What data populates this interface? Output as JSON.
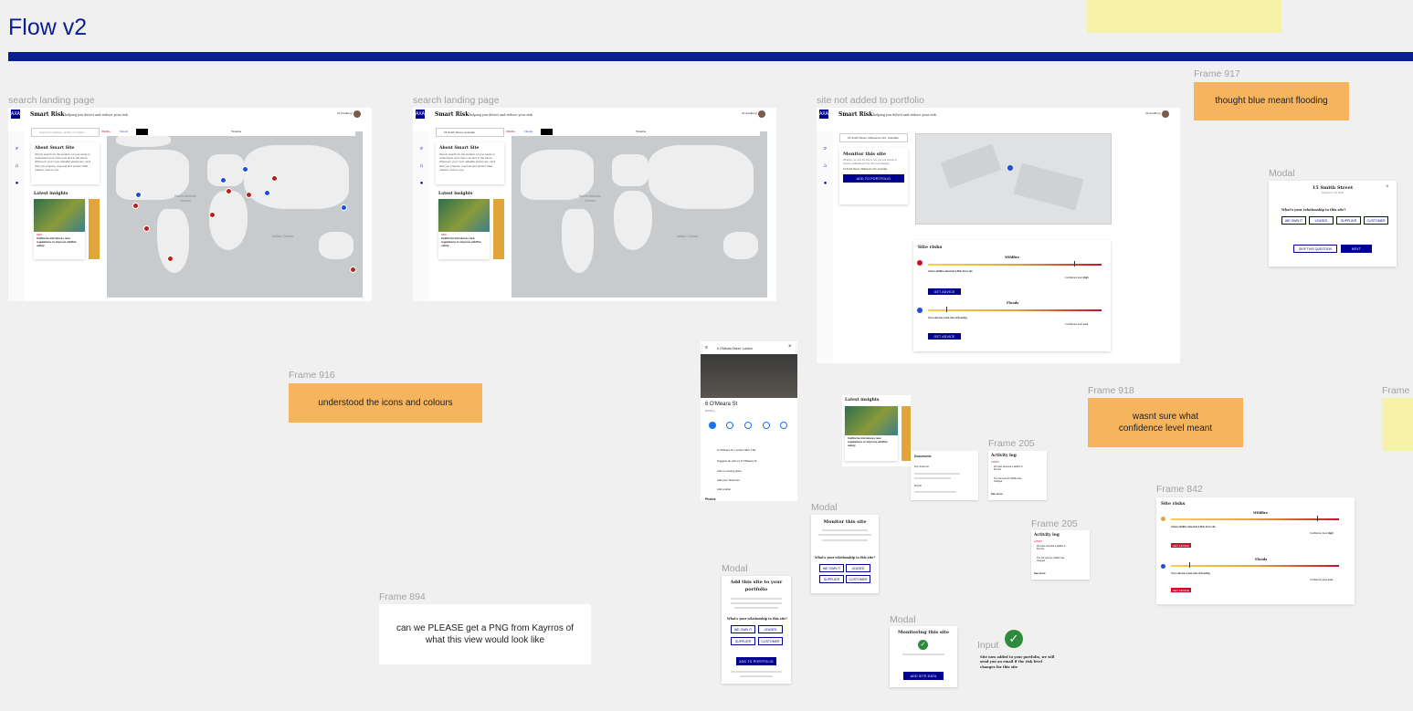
{
  "page_title": "Flow v2",
  "colors": {
    "brand_navy": "#00008f",
    "header_bar": "#0a1f8f",
    "risk_red": "#c8102e",
    "sticky_orange": "#f5b45d",
    "sticky_yellow": "#f6f3a8",
    "success_green": "#2e8b3e"
  },
  "frames": {
    "search1": "search landing page",
    "search2": "search landing page",
    "site_not_added": "site not added to portfolio",
    "f917": "Frame 917",
    "modal_right": "Modal",
    "f916": "Frame 916",
    "f918": "Frame 918",
    "frame_edge": "Frame",
    "f205a": "Frame 205",
    "f205b": "Frame 205",
    "f842": "Frame 842",
    "modal_mid": "Modal",
    "modal_left": "Modal",
    "f894": "Frame 894",
    "modal_bottom": "Modal",
    "input": "Input"
  },
  "notes": {
    "f917": "thought blue meant flooding",
    "f916": "understood the icons and colours",
    "f918": "wasnt sure what confidence level meant",
    "f894": "can we PLEASE get a PNG from Kayrros of what this view would look like"
  },
  "app": {
    "brand": "Smart Risk",
    "tagline": "helping you detect and reduce your risk",
    "user_name": "Ali Goldberg",
    "search_placeholder": "Search an address, facility or location",
    "search_value2": "15 Smith Street, Australia",
    "search_value3": "15 Smith Street, Melbourne VIC, Australia",
    "filter_wildfire": "Wildfire",
    "filter_floods": "Floods",
    "timeline": "Timeline",
    "about_title": "About Smart Site",
    "about_text": "Simply search for the location of your asset to understand your risks now and in the future. Wherever your most valuable assets are, we'll help you prepare, respond and protect what matters most to you.",
    "latest_insights": "Latest insights",
    "insight_tag": "NEW",
    "insight_title": "California introduces new regulations to improve wildfire safety",
    "map_ocean1": "North Atlantic Ocean",
    "map_ocean2": "Indian Ocean",
    "map_ocean3": "South Atlantic Ocean"
  },
  "monitor": {
    "title": "Monitor this site",
    "desc": "Whether you own the site or not, you can choose to receive notifications if the risk level changes.",
    "address": "15 Smith Street, Melbourne VIC, Australia",
    "add_btn": "ADD TO PORTFOLIO"
  },
  "site_risks": {
    "title": "Site risks",
    "wildfire": "Wildfire",
    "floods": "Floods",
    "wildfire_sub": "Active wildfire detected 4.5km from site",
    "flood_sub": "Your site has a low risk of flooding",
    "confidence": "Confidence level",
    "conf_high": "High",
    "conf_low": "Low",
    "get_advice": "GET ADVICE",
    "low": "Low",
    "high": "High"
  },
  "modal_right": {
    "title": "15 Smith Street",
    "subtitle": "Melbourne VIC 3000",
    "question": "What's your relationship to this site?",
    "options": [
      "WE OWN IT",
      "LEASED",
      "SUPPLIER",
      "CUSTOMER"
    ],
    "skip": "SKIP THIS QUESTION",
    "next": "NEXT"
  },
  "gmaps": {
    "search": "6 O'Meara Street, London",
    "place": "6 O'Meara St",
    "place_type": "Building",
    "actions": [
      "Directions",
      "Save",
      "Nearby",
      "Send to phone",
      "Share"
    ],
    "rows": [
      "6 O'Meara St, London SE1 1TE",
      "Suggest an edit on 6 O'Meara St",
      "Add a missing place",
      "Add your business",
      "Add a label"
    ],
    "photos": "Photos"
  },
  "documents": {
    "title": "Documents",
    "group1": "Fire check list",
    "group2": "Floods"
  },
  "activity": {
    "title": "Activity log",
    "latest": "LATEST",
    "item1": "We have detected a wildfire in this site",
    "item2": "The risk level for wildfire has changed",
    "see_more": "See more"
  },
  "modal_mid": {
    "title": "Monitor this site",
    "question": "What's your relationship to this site?",
    "options": [
      "WE OWN IT",
      "LEASED",
      "SUPPLIER",
      "CUSTOMER"
    ]
  },
  "modal_left": {
    "title": "Add this site to your portfolio",
    "question": "What's your relationship to this site?",
    "options": [
      "WE OWN IT",
      "LEASED",
      "SUPPLIER",
      "CUSTOMER"
    ],
    "btn": "ADD TO PORTFOLIO"
  },
  "modal_bottom": {
    "title": "Monitoring this site",
    "btn": "ADD SITE DATA"
  },
  "input_msg": "Site now added to your portfolio, we will send you an email if the risk level changes for this site"
}
